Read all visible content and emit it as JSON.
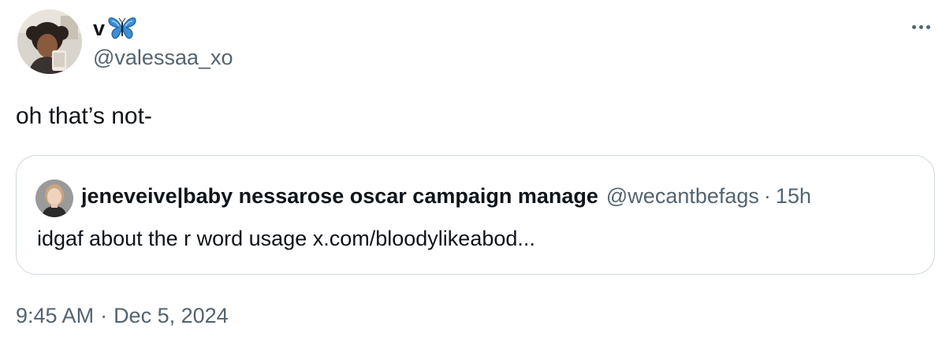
{
  "author": {
    "display_name": "v",
    "name_emoji_icon": "butterfly-icon",
    "handle": "@valessaa_xo"
  },
  "tweet": {
    "text": "oh that’s not-"
  },
  "quoted_tweet": {
    "display_name": "jeneveive|baby nessarose oscar campaign manage",
    "handle": "@wecantbefags",
    "separator": "·",
    "age": "15h",
    "text": "idgaf about the r word usage ",
    "link": "x.com/bloodylikeabod..."
  },
  "meta": {
    "time": "9:45 AM",
    "separator": "·",
    "date": "Dec 5, 2024"
  },
  "colors": {
    "text_primary": "#0f1419",
    "text_secondary": "#536471",
    "border": "#cfd9de",
    "butterfly_blue": "#3a8fd6"
  }
}
